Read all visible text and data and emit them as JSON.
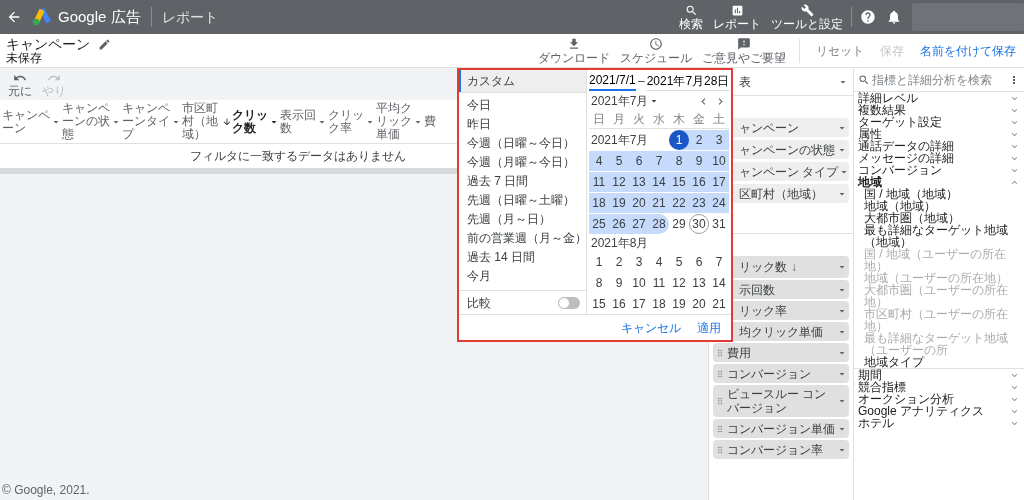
{
  "top_bar": {
    "app_name": "Google 広告",
    "section": "レポート",
    "actions": [
      {
        "label": "検索"
      },
      {
        "label": "レポート"
      },
      {
        "label": "ツールと設定"
      }
    ]
  },
  "header": {
    "title": "キャンペーン",
    "status": "未保存",
    "tools": [
      {
        "label": "ダウンロード"
      },
      {
        "label": "スケジュール"
      },
      {
        "label": "ご意見やご要望"
      }
    ],
    "buttons": [
      {
        "label": "リセット",
        "kind": "text",
        "disabled": false
      },
      {
        "label": "保存",
        "kind": "text",
        "disabled": true
      },
      {
        "label": "名前を付けて保存",
        "kind": "primary",
        "disabled": false
      }
    ]
  },
  "toolbar": [
    {
      "label": "元に",
      "disabled": false
    },
    {
      "label": "やり",
      "disabled": true
    }
  ],
  "table": {
    "columns": [
      {
        "label": "キャンペーン",
        "sorted": false,
        "menu": true
      },
      {
        "label": "キャンペーンの状態",
        "sorted": false,
        "menu": true
      },
      {
        "label": "キャンペーンタイプ",
        "sorted": false,
        "menu": true
      },
      {
        "label": "市区町村（地域）",
        "sorted": false,
        "menu": false
      },
      {
        "label": "クリック数",
        "sorted": true,
        "menu": true
      },
      {
        "label": "表示回数",
        "sorted": false,
        "menu": true
      },
      {
        "label": "クリック率",
        "sorted": false,
        "menu": true
      },
      {
        "label": "平均クリック単価",
        "sorted": false,
        "menu": true
      },
      {
        "label": "費",
        "sorted": false,
        "menu": false
      }
    ],
    "empty_message": "フィルタに一致するデータはありません"
  },
  "footer": "© Google, 2021.",
  "date_picker": {
    "presets": [
      {
        "label": "カスタム",
        "selected": true
      },
      {
        "label": "今日",
        "selected": false
      },
      {
        "label": "昨日",
        "selected": false
      },
      {
        "label": "今週（日曜～今日）",
        "selected": false
      },
      {
        "label": "今週（月曜～今日）",
        "selected": false
      },
      {
        "label": "過去 7 日間",
        "selected": false
      },
      {
        "label": "先週（日曜～土曜）",
        "selected": false
      },
      {
        "label": "先週（月～日）",
        "selected": false
      },
      {
        "label": "前の営業週（月～金）",
        "selected": false
      },
      {
        "label": "過去 14 日間",
        "selected": false
      },
      {
        "label": "今月",
        "selected": false
      }
    ],
    "compare": {
      "label": "比較",
      "on": false
    },
    "start": {
      "value": "2021/7/1",
      "focused": true
    },
    "separator": "–",
    "end": {
      "value": "2021年7月28日",
      "focused": false
    },
    "month_selector": "2021年7月",
    "weekdays": [
      "日",
      "月",
      "火",
      "水",
      "木",
      "金",
      "土"
    ],
    "months": [
      {
        "label": "2021年7月",
        "weeks": [
          [
            {
              "d": "1",
              "kind": "start",
              "today": false
            },
            {
              "d": "2",
              "kind": "middle",
              "today": false
            },
            {
              "d": "3",
              "kind": "middle",
              "today": false
            }
          ],
          [
            {
              "d": "4",
              "kind": "middle",
              "today": false
            },
            {
              "d": "5",
              "kind": "middle",
              "today": false
            },
            {
              "d": "6",
              "kind": "middle",
              "today": false
            },
            {
              "d": "7",
              "kind": "middle",
              "today": false
            },
            {
              "d": "8",
              "kind": "middle",
              "today": false
            },
            {
              "d": "9",
              "kind": "middle",
              "today": false
            },
            {
              "d": "10",
              "kind": "middle",
              "today": false
            }
          ],
          [
            {
              "d": "11",
              "kind": "middle",
              "today": false
            },
            {
              "d": "12",
              "kind": "middle",
              "today": false
            },
            {
              "d": "13",
              "kind": "middle",
              "today": false
            },
            {
              "d": "14",
              "kind": "middle",
              "today": false
            },
            {
              "d": "15",
              "kind": "middle",
              "today": false
            },
            {
              "d": "16",
              "kind": "middle",
              "today": false
            },
            {
              "d": "17",
              "kind": "middle",
              "today": false
            }
          ],
          [
            {
              "d": "18",
              "kind": "middle",
              "today": false
            },
            {
              "d": "19",
              "kind": "middle",
              "today": false
            },
            {
              "d": "20",
              "kind": "middle",
              "today": false
            },
            {
              "d": "21",
              "kind": "middle",
              "today": false
            },
            {
              "d": "22",
              "kind": "middle",
              "today": false
            },
            {
              "d": "23",
              "kind": "middle",
              "today": false
            },
            {
              "d": "24",
              "kind": "middle",
              "today": false
            }
          ],
          [
            {
              "d": "25",
              "kind": "middle",
              "today": false
            },
            {
              "d": "26",
              "kind": "middle",
              "today": false
            },
            {
              "d": "27",
              "kind": "middle",
              "today": false
            },
            {
              "d": "28",
              "kind": "end",
              "today": false
            },
            {
              "d": "29",
              "kind": "plain",
              "today": false
            },
            {
              "d": "30",
              "kind": "plain",
              "today": true
            },
            {
              "d": "31",
              "kind": "plain",
              "today": false
            }
          ]
        ]
      },
      {
        "label": "2021年8月",
        "weeks": [
          [
            {
              "d": "1",
              "kind": "plain",
              "today": false
            },
            {
              "d": "2",
              "kind": "plain",
              "today": false
            },
            {
              "d": "3",
              "kind": "plain",
              "today": false
            },
            {
              "d": "4",
              "kind": "plain",
              "today": false
            },
            {
              "d": "5",
              "kind": "plain",
              "today": false
            },
            {
              "d": "6",
              "kind": "plain",
              "today": false
            },
            {
              "d": "7",
              "kind": "plain",
              "today": false
            }
          ],
          [
            {
              "d": "8",
              "kind": "plain",
              "today": false
            },
            {
              "d": "9",
              "kind": "plain",
              "today": false
            },
            {
              "d": "10",
              "kind": "plain",
              "today": false
            },
            {
              "d": "11",
              "kind": "plain",
              "today": false
            },
            {
              "d": "12",
              "kind": "plain",
              "today": false
            },
            {
              "d": "13",
              "kind": "plain",
              "today": false
            },
            {
              "d": "14",
              "kind": "plain",
              "today": false
            }
          ],
          [
            {
              "d": "15",
              "kind": "plain",
              "today": false
            },
            {
              "d": "16",
              "kind": "plain",
              "today": false
            },
            {
              "d": "17",
              "kind": "plain",
              "today": false
            },
            {
              "d": "18",
              "kind": "plain",
              "today": false
            },
            {
              "d": "19",
              "kind": "plain",
              "today": false
            },
            {
              "d": "20",
              "kind": "plain",
              "today": false
            },
            {
              "d": "21",
              "kind": "plain",
              "today": false
            }
          ]
        ]
      }
    ],
    "buttons": [
      {
        "label": "キャンセル"
      },
      {
        "label": "適用"
      }
    ]
  },
  "middle_panel": {
    "header": "表",
    "row_chips": [
      {
        "label": "ャンペーン"
      },
      {
        "label": "ャンペーンの状態"
      },
      {
        "label": "ャンペーン タイプ"
      },
      {
        "label": "区町村（地域）"
      }
    ],
    "column_chips": [
      {
        "label": "リック数",
        "sort_mark": "↓",
        "handle": false
      },
      {
        "label": "示回数",
        "handle": false
      },
      {
        "label": "リック率",
        "handle": false
      },
      {
        "label": "均クリック単価",
        "handle": false
      },
      {
        "label": "費用",
        "handle": true
      },
      {
        "label": "コンバージョン",
        "handle": true
      },
      {
        "label": "ビュースルー コンバージョン",
        "handle": true
      },
      {
        "label": "コンバージョン単価",
        "handle": true
      },
      {
        "label": "コンバージョン率",
        "handle": true
      }
    ]
  },
  "right_panel": {
    "search": {
      "placeholder": "指標と詳細分析を検索"
    },
    "categories": [
      {
        "label": "詳細レベル",
        "expanded": false
      },
      {
        "label": "複数結果",
        "expanded": false
      },
      {
        "label": "ターゲット設定",
        "expanded": false
      },
      {
        "label": "属性",
        "expanded": false
      },
      {
        "label": "通話データの詳細",
        "expanded": false
      },
      {
        "label": "メッセージの詳細",
        "expanded": false
      },
      {
        "label": "コンバージョン",
        "expanded": false
      },
      {
        "label": "地域",
        "expanded": true,
        "children": [
          {
            "label": "国 / 地域（地域）",
            "disabled": false
          },
          {
            "label": "地域（地域）",
            "disabled": false
          },
          {
            "label": "大都市圏（地域）",
            "disabled": false
          },
          {
            "label": "最も詳細なターゲット地域（地域）",
            "disabled": false
          },
          {
            "label": "国 / 地域（ユーザーの所在地）",
            "disabled": true
          },
          {
            "label": "地域（ユーザーの所在地）",
            "disabled": true
          },
          {
            "label": "大都市圏（ユーザーの所在地）",
            "disabled": true
          },
          {
            "label": "市区町村（ユーザーの所在地）",
            "disabled": true
          },
          {
            "label": "最も詳細なターゲット地域（ユーザーの所",
            "disabled": true
          },
          {
            "label": "地域タイプ",
            "disabled": false
          }
        ]
      },
      {
        "label": "期間",
        "expanded": false
      },
      {
        "label": "競合指標",
        "expanded": false
      },
      {
        "label": "オークション分析",
        "expanded": false
      },
      {
        "label": "Google アナリティクス",
        "expanded": false
      },
      {
        "label": "ホテル",
        "expanded": false
      }
    ]
  }
}
